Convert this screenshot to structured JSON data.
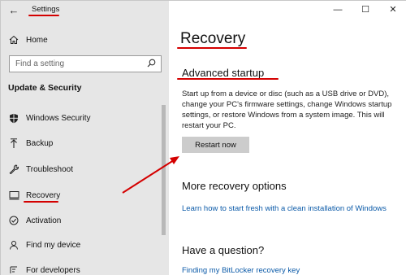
{
  "window": {
    "title": "Settings",
    "controls": [
      "—",
      "☐",
      "✕"
    ]
  },
  "sidebar": {
    "home_label": "Home",
    "search_placeholder": "Find a setting",
    "section_heading": "Update & Security",
    "items": [
      {
        "label": "Windows Security",
        "icon": "shield-icon"
      },
      {
        "label": "Backup",
        "icon": "backup-arrow-icon"
      },
      {
        "label": "Troubleshoot",
        "icon": "wrench-icon"
      },
      {
        "label": "Recovery",
        "icon": "recovery-icon",
        "selected": true
      },
      {
        "label": "Activation",
        "icon": "check-circle-icon"
      },
      {
        "label": "Find my device",
        "icon": "person-location-icon"
      },
      {
        "label": "For developers",
        "icon": "developer-icon"
      }
    ]
  },
  "main": {
    "page_title": "Recovery",
    "advanced_startup": {
      "heading": "Advanced startup",
      "description": "Start up from a device or disc (such as a USB drive or DVD), change your PC's firmware settings, change Windows startup settings, or restore Windows from a system image. This will restart your PC.",
      "button_label": "Restart now"
    },
    "more_options": {
      "heading": "More recovery options",
      "link": "Learn how to start fresh with a clean installation of Windows"
    },
    "question": {
      "heading": "Have a question?",
      "link": "Finding my BitLocker recovery key"
    }
  },
  "colors": {
    "sidebar_bg": "#e6e6e6",
    "accent": "#0b5aa8",
    "annotation": "#d40000",
    "button_bg": "#cccccc"
  }
}
